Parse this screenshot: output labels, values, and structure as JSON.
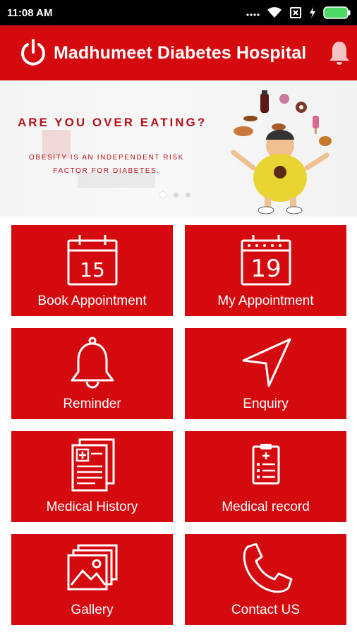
{
  "status_bar": {
    "time": "11:08 AM",
    "icons": [
      "signal-dots-icon",
      "wifi-icon",
      "sim-icon",
      "charging-icon",
      "battery-icon"
    ]
  },
  "app_bar": {
    "title": "Madhumeet Diabetes Hospital",
    "left_icon": "power-icon",
    "right_icon": "bell-icon"
  },
  "banner": {
    "headline": "ARE YOU OVER EATING?",
    "subtext": "OBESITY IS AN INDEPENDENT RISK FACTOR FOR DIABETES.",
    "slides_total": 3,
    "active_slide": 1
  },
  "tiles": [
    {
      "label": "Book Appointment",
      "icon": "calendar-15-icon",
      "cal_number": "15"
    },
    {
      "label": "My Appointment",
      "icon": "calendar-19-icon",
      "cal_number": "19"
    },
    {
      "label": "Reminder",
      "icon": "bell-icon"
    },
    {
      "label": "Enquiry",
      "icon": "navigation-arrow-icon"
    },
    {
      "label": "Medical History",
      "icon": "medical-history-icon"
    },
    {
      "label": "Medical record",
      "icon": "clipboard-icon"
    },
    {
      "label": "Gallery",
      "icon": "gallery-icon"
    },
    {
      "label": "Contact US",
      "icon": "phone-icon"
    }
  ],
  "colors": {
    "primary": "#d40a0f",
    "banner_text": "#b3131c",
    "status_bar": "#000000",
    "battery": "#4cd964"
  }
}
